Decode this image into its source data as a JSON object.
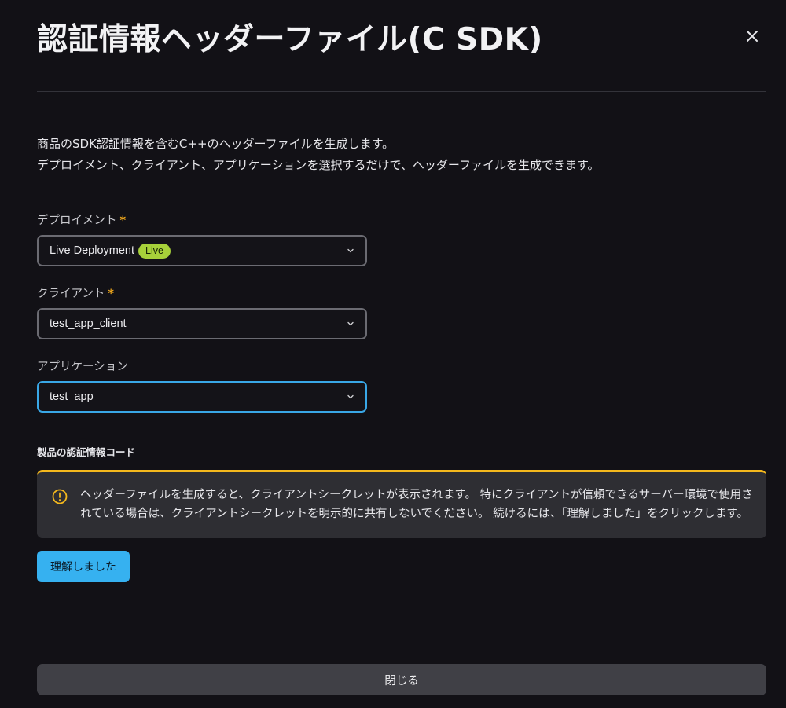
{
  "dialog": {
    "title": "認証情報ヘッダーファイル(C SDK)",
    "close_icon": "close-icon"
  },
  "description": {
    "line1": "商品のSDK認証情報を含むC++のヘッダーファイルを生成します。",
    "line2": "デプロイメント、クライアント、アプリケーションを選択するだけで、ヘッダーファイルを生成できます。"
  },
  "fields": {
    "deployment": {
      "label": "デプロイメント",
      "required_mark": "*",
      "value": "Live Deployment",
      "badge": "Live"
    },
    "client": {
      "label": "クライアント",
      "required_mark": "*",
      "value": "test_app_client"
    },
    "application": {
      "label": "アプリケーション",
      "value": "test_app"
    }
  },
  "credentials_section": {
    "heading": "製品の認証情報コード",
    "warning_text": "ヘッダーファイルを生成すると、クライアントシークレットが表示されます。 特にクライアントが信頼できるサーバー環境で使用されている場合は、クライアントシークレットを明示的に共有しないでください。 続けるには、「理解しました」をクリックします。",
    "warning_icon": "warning-circle-icon",
    "ack_button": "理解しました"
  },
  "footer": {
    "close_button": "閉じる"
  },
  "colors": {
    "background": "#121116",
    "accent_blue": "#36b1f0",
    "warning_yellow": "#f4b81d",
    "live_badge": "#a7d13a",
    "required_asterisk": "#f0a81c"
  }
}
